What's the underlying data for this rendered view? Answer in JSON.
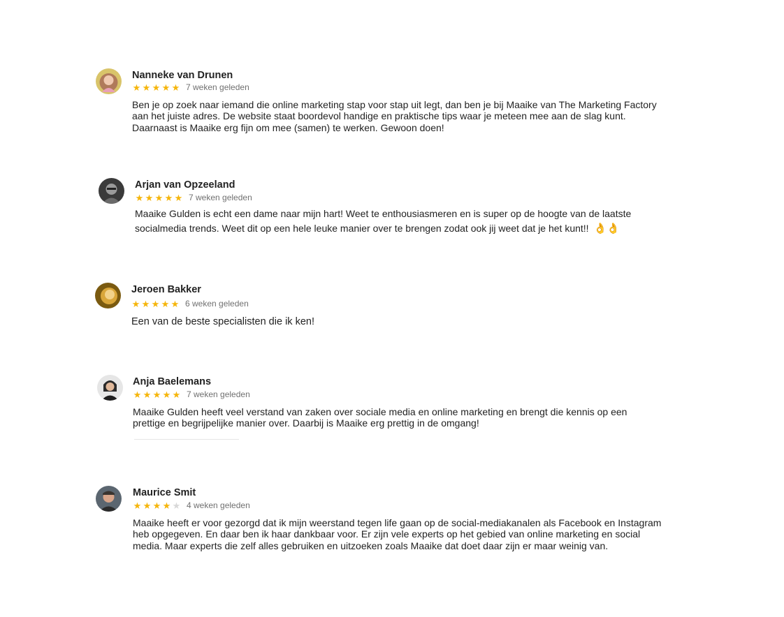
{
  "reviews": [
    {
      "name": "Nanneke van Drunen",
      "rating": 5,
      "stars": [
        "★",
        "★",
        "★",
        "★",
        "★"
      ],
      "time": "7 weken geleden",
      "text": "Ben je op zoek naar iemand die online marketing stap voor stap uit legt, dan ben je bij Maaike van The Marketing Factory aan het juiste adres. De website staat boordevol handige en praktische tips waar je meteen mee aan de slag kunt. Daarnaast is Maaike erg fijn om mee (samen) te werken. Gewoon doen!"
    },
    {
      "name": "Arjan van Opzeeland",
      "rating": 5,
      "stars": [
        "★",
        "★",
        "★",
        "★",
        "★"
      ],
      "time": "7 weken geleden",
      "text": "Maaike Gulden is echt een dame naar mijn hart! Weet te enthousiasmeren en is super op de hoogte van de laatste socialmedia trends. Weet dit op een hele leuke manier over te brengen zodat ook jij weet dat je het kunt!!",
      "emoji": "👌👌"
    },
    {
      "name": "Jeroen Bakker",
      "rating": 5,
      "stars": [
        "★",
        "★",
        "★",
        "★",
        "★"
      ],
      "time": "6 weken geleden",
      "text": "Een van de beste specialisten die ik ken!"
    },
    {
      "name": "Anja Baelemans",
      "rating": 5,
      "stars": [
        "★",
        "★",
        "★",
        "★",
        "★"
      ],
      "time": "7 weken geleden",
      "text": "Maaike Gulden heeft veel verstand van zaken over sociale media en online marketing en brengt die kennis op een prettige en begrijpelijke manier over. Daarbij is Maaike erg prettig in de omgang!"
    },
    {
      "name": "Maurice Smit",
      "rating": 4,
      "stars": [
        "★",
        "★",
        "★",
        "★",
        "★"
      ],
      "time": "4 weken geleden",
      "text": "Maaike heeft er voor gezorgd dat ik mijn weerstand tegen life gaan op de social-mediakanalen als Facebook en Instagram heb opgegeven. En daar ben ik haar dankbaar voor. Er zijn vele experts op het gebied van online marketing en social media. Maar experts die zelf alles gebruiken en uitzoeken zoals Maaike dat doet daar zijn er maar weinig van."
    }
  ],
  "colors": {
    "star_filled": "#f5b50a",
    "star_empty": "#d8d8d8",
    "name": "#222222",
    "time": "#707070",
    "text": "#222222"
  },
  "icons": {
    "avatar": "user-avatar",
    "star": "star-icon",
    "emoji": "ok-hand-emoji"
  }
}
